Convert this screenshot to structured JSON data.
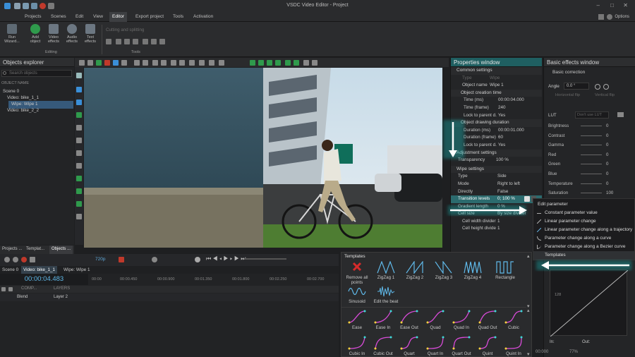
{
  "app": {
    "title": "VSDC Video Editor - Project",
    "options": "Options"
  },
  "menu": [
    "Projects",
    "Scenes",
    "Edit",
    "View",
    "Editor",
    "Export project",
    "Tools",
    "Activation"
  ],
  "ribbon": {
    "run_wizard": "Run Wizard...",
    "add_object": "Add object",
    "video_effects": "Video effects",
    "audio_effects": "Audio effects",
    "text_effects": "Text effects",
    "editing": "Editing",
    "cutting": "Cutting and splitting",
    "tools": "Tools"
  },
  "objects_explorer": {
    "title": "Objects explorer",
    "search_placeholder": "Search objects",
    "col": "OBJECT NAME",
    "tree": [
      "Scene 0",
      "Video: bike_1_1",
      "Wipe: Wipe 1",
      "Video: bike_2_2"
    ]
  },
  "bottom_tabs": [
    "Projects ...",
    "Templat...",
    "Objects ..."
  ],
  "timeline": {
    "resolution": "720p",
    "tabs": [
      "Scene 0",
      "Video: bike_1_1",
      "Wipe: Wipe 1"
    ],
    "time": "00:00:04.483",
    "comp": "COMP...",
    "layers": "LAYERS",
    "blend": "Blend",
    "layer": "Layer 2",
    "ticks": [
      "00:00",
      "00:00.450",
      "00:00.900",
      "00:01.350",
      "00:01.800",
      "00:02.250",
      "00:02.700"
    ]
  },
  "properties": {
    "title": "Properties window",
    "common": "Common settings",
    "rows": [
      [
        "Type",
        "Wipe"
      ],
      [
        "Object name",
        "Wipe 1"
      ]
    ],
    "creation": "Object creation time",
    "crows": [
      [
        "Time (ms)",
        "00:00:04.000"
      ],
      [
        "Time (frame)",
        "240"
      ],
      [
        "Lock to parent d.",
        "Yes"
      ]
    ],
    "drawing": "Object drawing duration",
    "drows": [
      [
        "Duration (ms)",
        "00:00:01.000"
      ],
      [
        "Duration (frame)",
        "60"
      ],
      [
        "Lock to parent d.",
        "Yes"
      ]
    ],
    "adjustment": "Adjustment settings",
    "transparency": [
      "Transparency",
      "100 %"
    ],
    "wipe": "Wipe settings",
    "wrows": [
      [
        "Type",
        "Side"
      ],
      [
        "Mode",
        "Right to left"
      ],
      [
        "Directly",
        "False"
      ],
      [
        "Transition levels",
        "0; 100 %"
      ],
      [
        "Gradient length",
        "0 %"
      ],
      [
        "Cell size",
        "By size divider"
      ],
      [
        "Cell width divider",
        "1"
      ],
      [
        "Cell height divide",
        "1"
      ]
    ]
  },
  "basic": {
    "title": "Basic effects window",
    "correction": "Basic correction",
    "angle": "Angle",
    "angle_value": "0.0 °",
    "hflip": "Horizontal flip",
    "vflip": "Vertical flip",
    "lut": "LUT",
    "lut_value": "Don't use LUT",
    "rows": [
      [
        "Brightness",
        "0"
      ],
      [
        "Contrast",
        "0"
      ],
      [
        "Gamma",
        "0"
      ],
      [
        "Red",
        "0"
      ],
      [
        "Green",
        "0"
      ],
      [
        "Blue",
        "0"
      ],
      [
        "Temperature",
        "0"
      ],
      [
        "Saturation",
        "100"
      ]
    ],
    "axis_label": "128",
    "in": "In:",
    "out": "Out:",
    "time": "00:000",
    "zoom": "77%"
  },
  "context_menu": {
    "items": [
      "Edit parameter",
      "Constant parameter value",
      "Linear parameter change",
      "Linear parameter change along a trajectory",
      "Parameter change along a curve",
      "Parameter change along a Bezier curve",
      "Templates"
    ]
  },
  "templates": {
    "title": "Templates",
    "row1": [
      "Remove all points",
      "ZigZag 1",
      "ZigZag 2",
      "ZigZag 3",
      "ZigZag 4",
      "Rectangle"
    ],
    "row2": [
      "Sinusoid",
      "Edit the beat"
    ],
    "easing": [
      "Ease",
      "Ease In",
      "Ease Out",
      "Quad",
      "Quad In",
      "Quad Out",
      "Cubic",
      "Cubic In",
      "Cubic Out",
      "Quart",
      "Quart In",
      "Quart Out",
      "Quint",
      "Quint In"
    ]
  },
  "colors": {
    "accent": "#1f5f61",
    "arrow": "#ffffff",
    "highlight": "#2c6b6e",
    "menu_bg": "#1c1c1e"
  }
}
